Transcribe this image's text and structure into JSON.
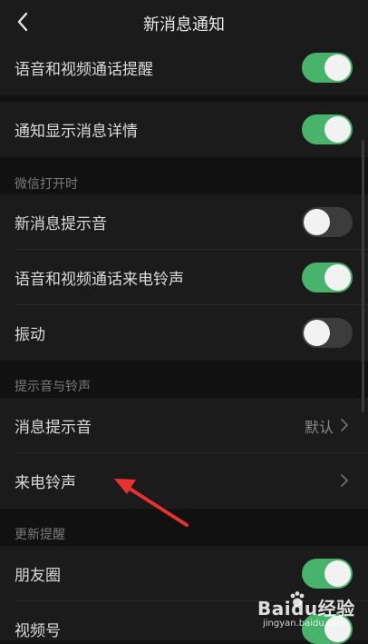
{
  "header": {
    "title": "新消息通知",
    "back_icon": "chevron-left-icon"
  },
  "rows": {
    "voice_video_reminder": {
      "label": "语音和视频通话提醒",
      "on": true
    },
    "show_details": {
      "label": "通知显示消息详情",
      "on": true
    },
    "new_message_sound": {
      "label": "新消息提示音",
      "on": false
    },
    "voice_video_ringtone": {
      "label": "语音和视频通话来电铃声",
      "on": true
    },
    "vibration": {
      "label": "振动",
      "on": false
    },
    "message_tone": {
      "label": "消息提示音",
      "value": "默认"
    },
    "incoming_ringtone": {
      "label": "来电铃声"
    },
    "moments": {
      "label": "朋友圈",
      "on": true
    },
    "channels": {
      "label": "视频号",
      "on": true
    }
  },
  "sections": {
    "wechat_open": "微信打开时",
    "tones": "提示音与铃声",
    "updates": "更新提醒"
  },
  "watermark": {
    "brand": "Baidu经验",
    "url": "jingyan.baidu.com"
  },
  "colors": {
    "toggle_on": "#47b36b",
    "toggle_off": "#3c3c3c",
    "background": "#111111",
    "cell": "#1b1b1b",
    "annotation_arrow": "#e8322e"
  }
}
